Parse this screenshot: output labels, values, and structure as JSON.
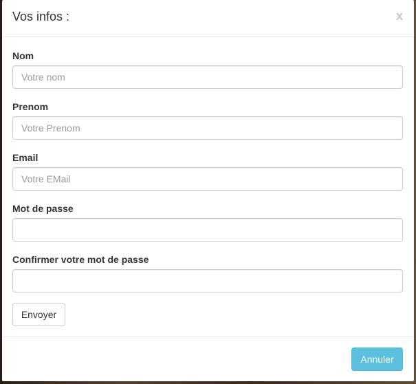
{
  "modal": {
    "title": "Vos infos :",
    "close_label": "x"
  },
  "form": {
    "fields": [
      {
        "label": "Nom",
        "placeholder": "Votre nom",
        "value": ""
      },
      {
        "label": "Prenom",
        "placeholder": "Votre Prenom",
        "value": ""
      },
      {
        "label": "Email",
        "placeholder": "Votre EMail",
        "value": ""
      },
      {
        "label": "Mot de passe",
        "placeholder": "",
        "value": ""
      },
      {
        "label": "Confirmer votre mot de passe",
        "placeholder": "",
        "value": ""
      }
    ],
    "submit_label": "Envoyer"
  },
  "footer": {
    "cancel_label": "Annuler"
  },
  "colors": {
    "cancel_button": "#5bc0de",
    "backdrop": "#3a2c1f"
  }
}
